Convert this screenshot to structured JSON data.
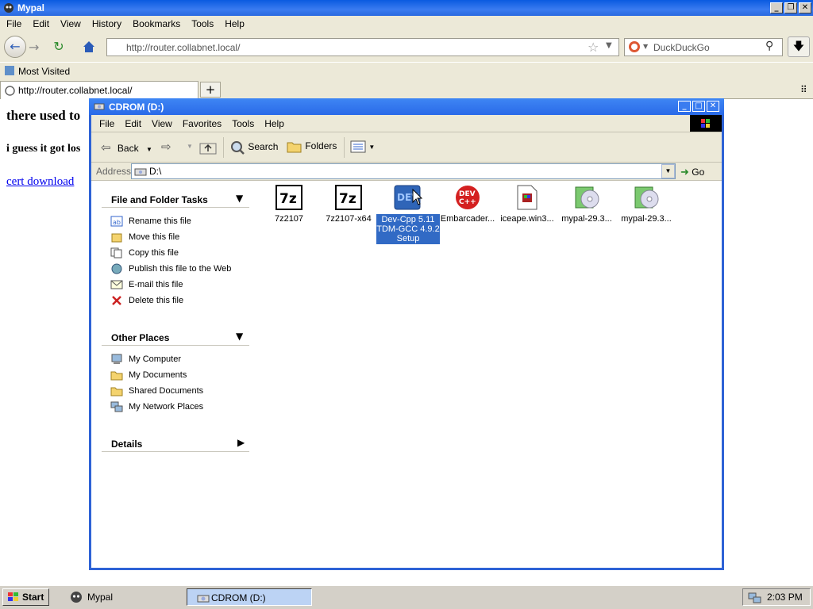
{
  "browser": {
    "title": "Mypal",
    "menu": [
      "File",
      "Edit",
      "View",
      "History",
      "Bookmarks",
      "Tools",
      "Help"
    ],
    "url": "http://router.collabnet.local/",
    "search_placeholder": "DuckDuckGo",
    "bookmark": "Most Visited",
    "tab_label": "http://router.collabnet.local/",
    "new_tab": "+"
  },
  "page": {
    "heading": "there used to",
    "line2": "i guess it got los",
    "link": "cert download"
  },
  "explorer": {
    "title": "CDROM (D:)",
    "menu": [
      "File",
      "Edit",
      "View",
      "Favorites",
      "Tools",
      "Help"
    ],
    "toolbar": {
      "back": "Back",
      "search": "Search",
      "folders": "Folders"
    },
    "address_label": "Address",
    "address_value": "D:\\",
    "go": "Go",
    "tasks": {
      "file_tasks_title": "File and Folder Tasks",
      "file_tasks": [
        "Rename this file",
        "Move this file",
        "Copy this file",
        "Publish this file to the Web",
        "E-mail this file",
        "Delete this file"
      ],
      "other_places_title": "Other Places",
      "other_places": [
        "My Computer",
        "My Documents",
        "Shared Documents",
        "My Network Places"
      ],
      "details_title": "Details"
    },
    "files": [
      {
        "label": "7z2107"
      },
      {
        "label": "7z2107-x64"
      },
      {
        "label": "Dev-Cpp 5.11 TDM-GCC 4.9.2 Setup"
      },
      {
        "label": "Embarcader..."
      },
      {
        "label": "iceape.win3..."
      },
      {
        "label": "mypal-29.3..."
      },
      {
        "label": "mypal-29.3..."
      }
    ],
    "icon_text": {
      "sevenzip": "7z",
      "dev": "DEV",
      "devcpp1": "DEV",
      "devcpp2": "C++"
    }
  },
  "taskbar": {
    "start": "Start",
    "tasks": [
      "Mypal",
      "CDROM (D:)"
    ],
    "clock": "2:03 PM"
  },
  "colors": {
    "xp_blue": "#2e63d6",
    "selection": "#316ac5",
    "taskbar": "#d4d0c8"
  }
}
